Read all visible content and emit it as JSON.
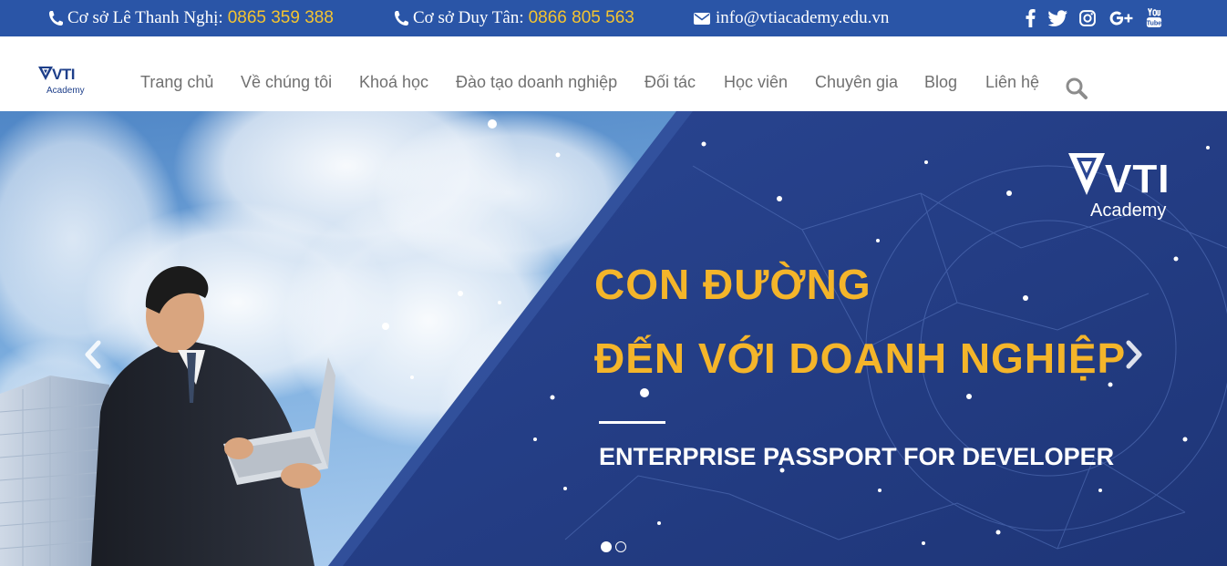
{
  "topbar": {
    "contacts": [
      {
        "label": "Cơ sở Lê Thanh Nghị:",
        "phone": "0865 359 388",
        "icon": "phone-icon"
      },
      {
        "label": "Cơ sở Duy Tân:",
        "phone": "0866 805 563",
        "icon": "phone-icon"
      },
      {
        "label": "info@vtiacademy.edu.vn",
        "icon": "envelope-icon"
      }
    ],
    "social": [
      "facebook-icon",
      "twitter-icon",
      "instagram-icon",
      "google-plus-icon",
      "youtube-icon"
    ],
    "colors": {
      "background": "#2a55a7",
      "accent": "#f4c430",
      "text": "#ffffff"
    }
  },
  "navbar": {
    "logo": {
      "brand": "VTI",
      "sub": "Academy"
    },
    "items": [
      "Trang chủ",
      "Về chúng tôi",
      "Khoá học",
      "Đào tạo doanh nghiệp",
      "Đối tác",
      "Học viên",
      "Chuyên gia",
      "Blog",
      "Liên hệ"
    ],
    "search_icon": "search-icon"
  },
  "hero": {
    "logo": {
      "brand": "VTI",
      "sub": "Academy"
    },
    "headline_1": "CON ĐƯỜNG",
    "headline_2": "ĐẾN VỚI DOANH NGHIỆP",
    "subline": "ENTERPRISE PASSPORT FOR DEVELOPER",
    "slides_total": 2,
    "active_slide": 1,
    "colors": {
      "panel": "#253f88",
      "headline": "#f4b52a",
      "sky": "#6fa3da"
    }
  }
}
